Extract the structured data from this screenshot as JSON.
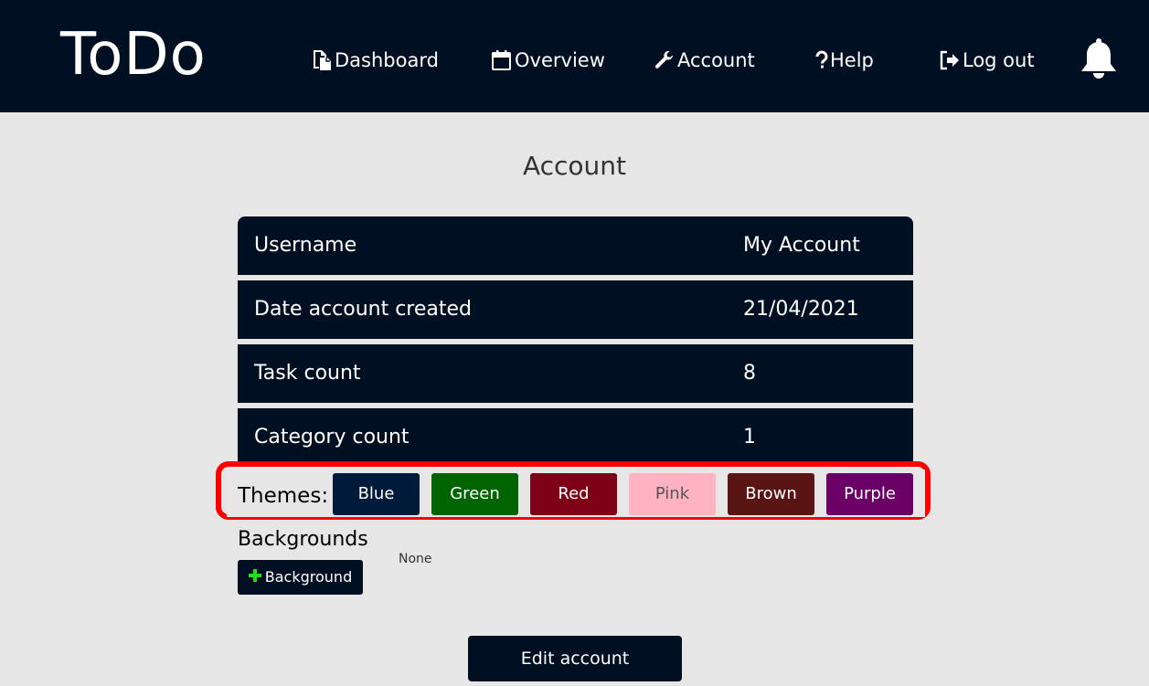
{
  "app": {
    "logo": "ToDo"
  },
  "nav": {
    "items": [
      {
        "label": "Dashboard",
        "icon": "dashboard-icon"
      },
      {
        "label": "Overview",
        "icon": "calendar-icon"
      },
      {
        "label": "Account",
        "icon": "wrench-icon"
      },
      {
        "label": "Help",
        "icon": "question-icon"
      },
      {
        "label": "Log out",
        "icon": "logout-icon"
      }
    ],
    "notifications_icon": "bell-icon"
  },
  "page": {
    "title": "Account"
  },
  "account": {
    "rows": [
      {
        "key": "Username",
        "value": "My Account"
      },
      {
        "key": "Date account created",
        "value": "21/04/2021"
      },
      {
        "key": "Task count",
        "value": "8"
      },
      {
        "key": "Category count",
        "value": "1"
      }
    ]
  },
  "themes": {
    "label": "Themes:",
    "options": [
      {
        "label": "Blue",
        "color": "#001a3a",
        "text_color": "#ffffff"
      },
      {
        "label": "Green",
        "color": "#006400",
        "text_color": "#ffffff"
      },
      {
        "label": "Red",
        "color": "#7d0017",
        "text_color": "#ffffff"
      },
      {
        "label": "Pink",
        "color": "#ffb3c0",
        "text_color": "#555555"
      },
      {
        "label": "Brown",
        "color": "#5a1413",
        "text_color": "#ffffff"
      },
      {
        "label": "Purple",
        "color": "#6b0066",
        "text_color": "#ffffff"
      }
    ],
    "highlight_color": "#ff0000"
  },
  "backgrounds": {
    "label": "Backgrounds",
    "current": "None",
    "add_button_label": "Background",
    "add_icon": "plus-icon"
  },
  "edit_button_label": "Edit account",
  "colors": {
    "navbar": "#001022",
    "page_background": "#e6e6e6",
    "accent_green": "#22dd22"
  }
}
